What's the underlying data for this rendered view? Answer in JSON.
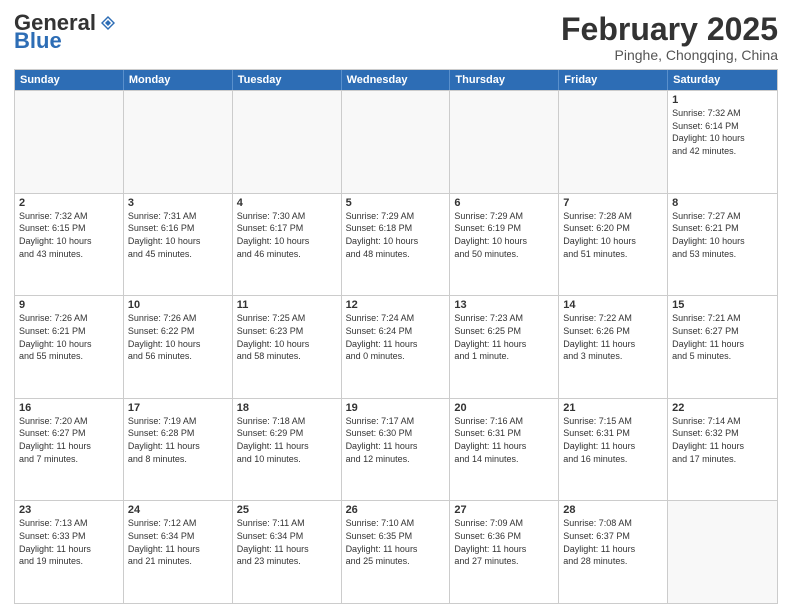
{
  "header": {
    "logo_general": "General",
    "logo_blue": "Blue",
    "month_title": "February 2025",
    "location": "Pinghe, Chongqing, China"
  },
  "weekdays": [
    "Sunday",
    "Monday",
    "Tuesday",
    "Wednesday",
    "Thursday",
    "Friday",
    "Saturday"
  ],
  "rows": [
    [
      {
        "day": "",
        "info": ""
      },
      {
        "day": "",
        "info": ""
      },
      {
        "day": "",
        "info": ""
      },
      {
        "day": "",
        "info": ""
      },
      {
        "day": "",
        "info": ""
      },
      {
        "day": "",
        "info": ""
      },
      {
        "day": "1",
        "info": "Sunrise: 7:32 AM\nSunset: 6:14 PM\nDaylight: 10 hours\nand 42 minutes."
      }
    ],
    [
      {
        "day": "2",
        "info": "Sunrise: 7:32 AM\nSunset: 6:15 PM\nDaylight: 10 hours\nand 43 minutes."
      },
      {
        "day": "3",
        "info": "Sunrise: 7:31 AM\nSunset: 6:16 PM\nDaylight: 10 hours\nand 45 minutes."
      },
      {
        "day": "4",
        "info": "Sunrise: 7:30 AM\nSunset: 6:17 PM\nDaylight: 10 hours\nand 46 minutes."
      },
      {
        "day": "5",
        "info": "Sunrise: 7:29 AM\nSunset: 6:18 PM\nDaylight: 10 hours\nand 48 minutes."
      },
      {
        "day": "6",
        "info": "Sunrise: 7:29 AM\nSunset: 6:19 PM\nDaylight: 10 hours\nand 50 minutes."
      },
      {
        "day": "7",
        "info": "Sunrise: 7:28 AM\nSunset: 6:20 PM\nDaylight: 10 hours\nand 51 minutes."
      },
      {
        "day": "8",
        "info": "Sunrise: 7:27 AM\nSunset: 6:21 PM\nDaylight: 10 hours\nand 53 minutes."
      }
    ],
    [
      {
        "day": "9",
        "info": "Sunrise: 7:26 AM\nSunset: 6:21 PM\nDaylight: 10 hours\nand 55 minutes."
      },
      {
        "day": "10",
        "info": "Sunrise: 7:26 AM\nSunset: 6:22 PM\nDaylight: 10 hours\nand 56 minutes."
      },
      {
        "day": "11",
        "info": "Sunrise: 7:25 AM\nSunset: 6:23 PM\nDaylight: 10 hours\nand 58 minutes."
      },
      {
        "day": "12",
        "info": "Sunrise: 7:24 AM\nSunset: 6:24 PM\nDaylight: 11 hours\nand 0 minutes."
      },
      {
        "day": "13",
        "info": "Sunrise: 7:23 AM\nSunset: 6:25 PM\nDaylight: 11 hours\nand 1 minute."
      },
      {
        "day": "14",
        "info": "Sunrise: 7:22 AM\nSunset: 6:26 PM\nDaylight: 11 hours\nand 3 minutes."
      },
      {
        "day": "15",
        "info": "Sunrise: 7:21 AM\nSunset: 6:27 PM\nDaylight: 11 hours\nand 5 minutes."
      }
    ],
    [
      {
        "day": "16",
        "info": "Sunrise: 7:20 AM\nSunset: 6:27 PM\nDaylight: 11 hours\nand 7 minutes."
      },
      {
        "day": "17",
        "info": "Sunrise: 7:19 AM\nSunset: 6:28 PM\nDaylight: 11 hours\nand 8 minutes."
      },
      {
        "day": "18",
        "info": "Sunrise: 7:18 AM\nSunset: 6:29 PM\nDaylight: 11 hours\nand 10 minutes."
      },
      {
        "day": "19",
        "info": "Sunrise: 7:17 AM\nSunset: 6:30 PM\nDaylight: 11 hours\nand 12 minutes."
      },
      {
        "day": "20",
        "info": "Sunrise: 7:16 AM\nSunset: 6:31 PM\nDaylight: 11 hours\nand 14 minutes."
      },
      {
        "day": "21",
        "info": "Sunrise: 7:15 AM\nSunset: 6:31 PM\nDaylight: 11 hours\nand 16 minutes."
      },
      {
        "day": "22",
        "info": "Sunrise: 7:14 AM\nSunset: 6:32 PM\nDaylight: 11 hours\nand 17 minutes."
      }
    ],
    [
      {
        "day": "23",
        "info": "Sunrise: 7:13 AM\nSunset: 6:33 PM\nDaylight: 11 hours\nand 19 minutes."
      },
      {
        "day": "24",
        "info": "Sunrise: 7:12 AM\nSunset: 6:34 PM\nDaylight: 11 hours\nand 21 minutes."
      },
      {
        "day": "25",
        "info": "Sunrise: 7:11 AM\nSunset: 6:34 PM\nDaylight: 11 hours\nand 23 minutes."
      },
      {
        "day": "26",
        "info": "Sunrise: 7:10 AM\nSunset: 6:35 PM\nDaylight: 11 hours\nand 25 minutes."
      },
      {
        "day": "27",
        "info": "Sunrise: 7:09 AM\nSunset: 6:36 PM\nDaylight: 11 hours\nand 27 minutes."
      },
      {
        "day": "28",
        "info": "Sunrise: 7:08 AM\nSunset: 6:37 PM\nDaylight: 11 hours\nand 28 minutes."
      },
      {
        "day": "",
        "info": ""
      }
    ]
  ]
}
